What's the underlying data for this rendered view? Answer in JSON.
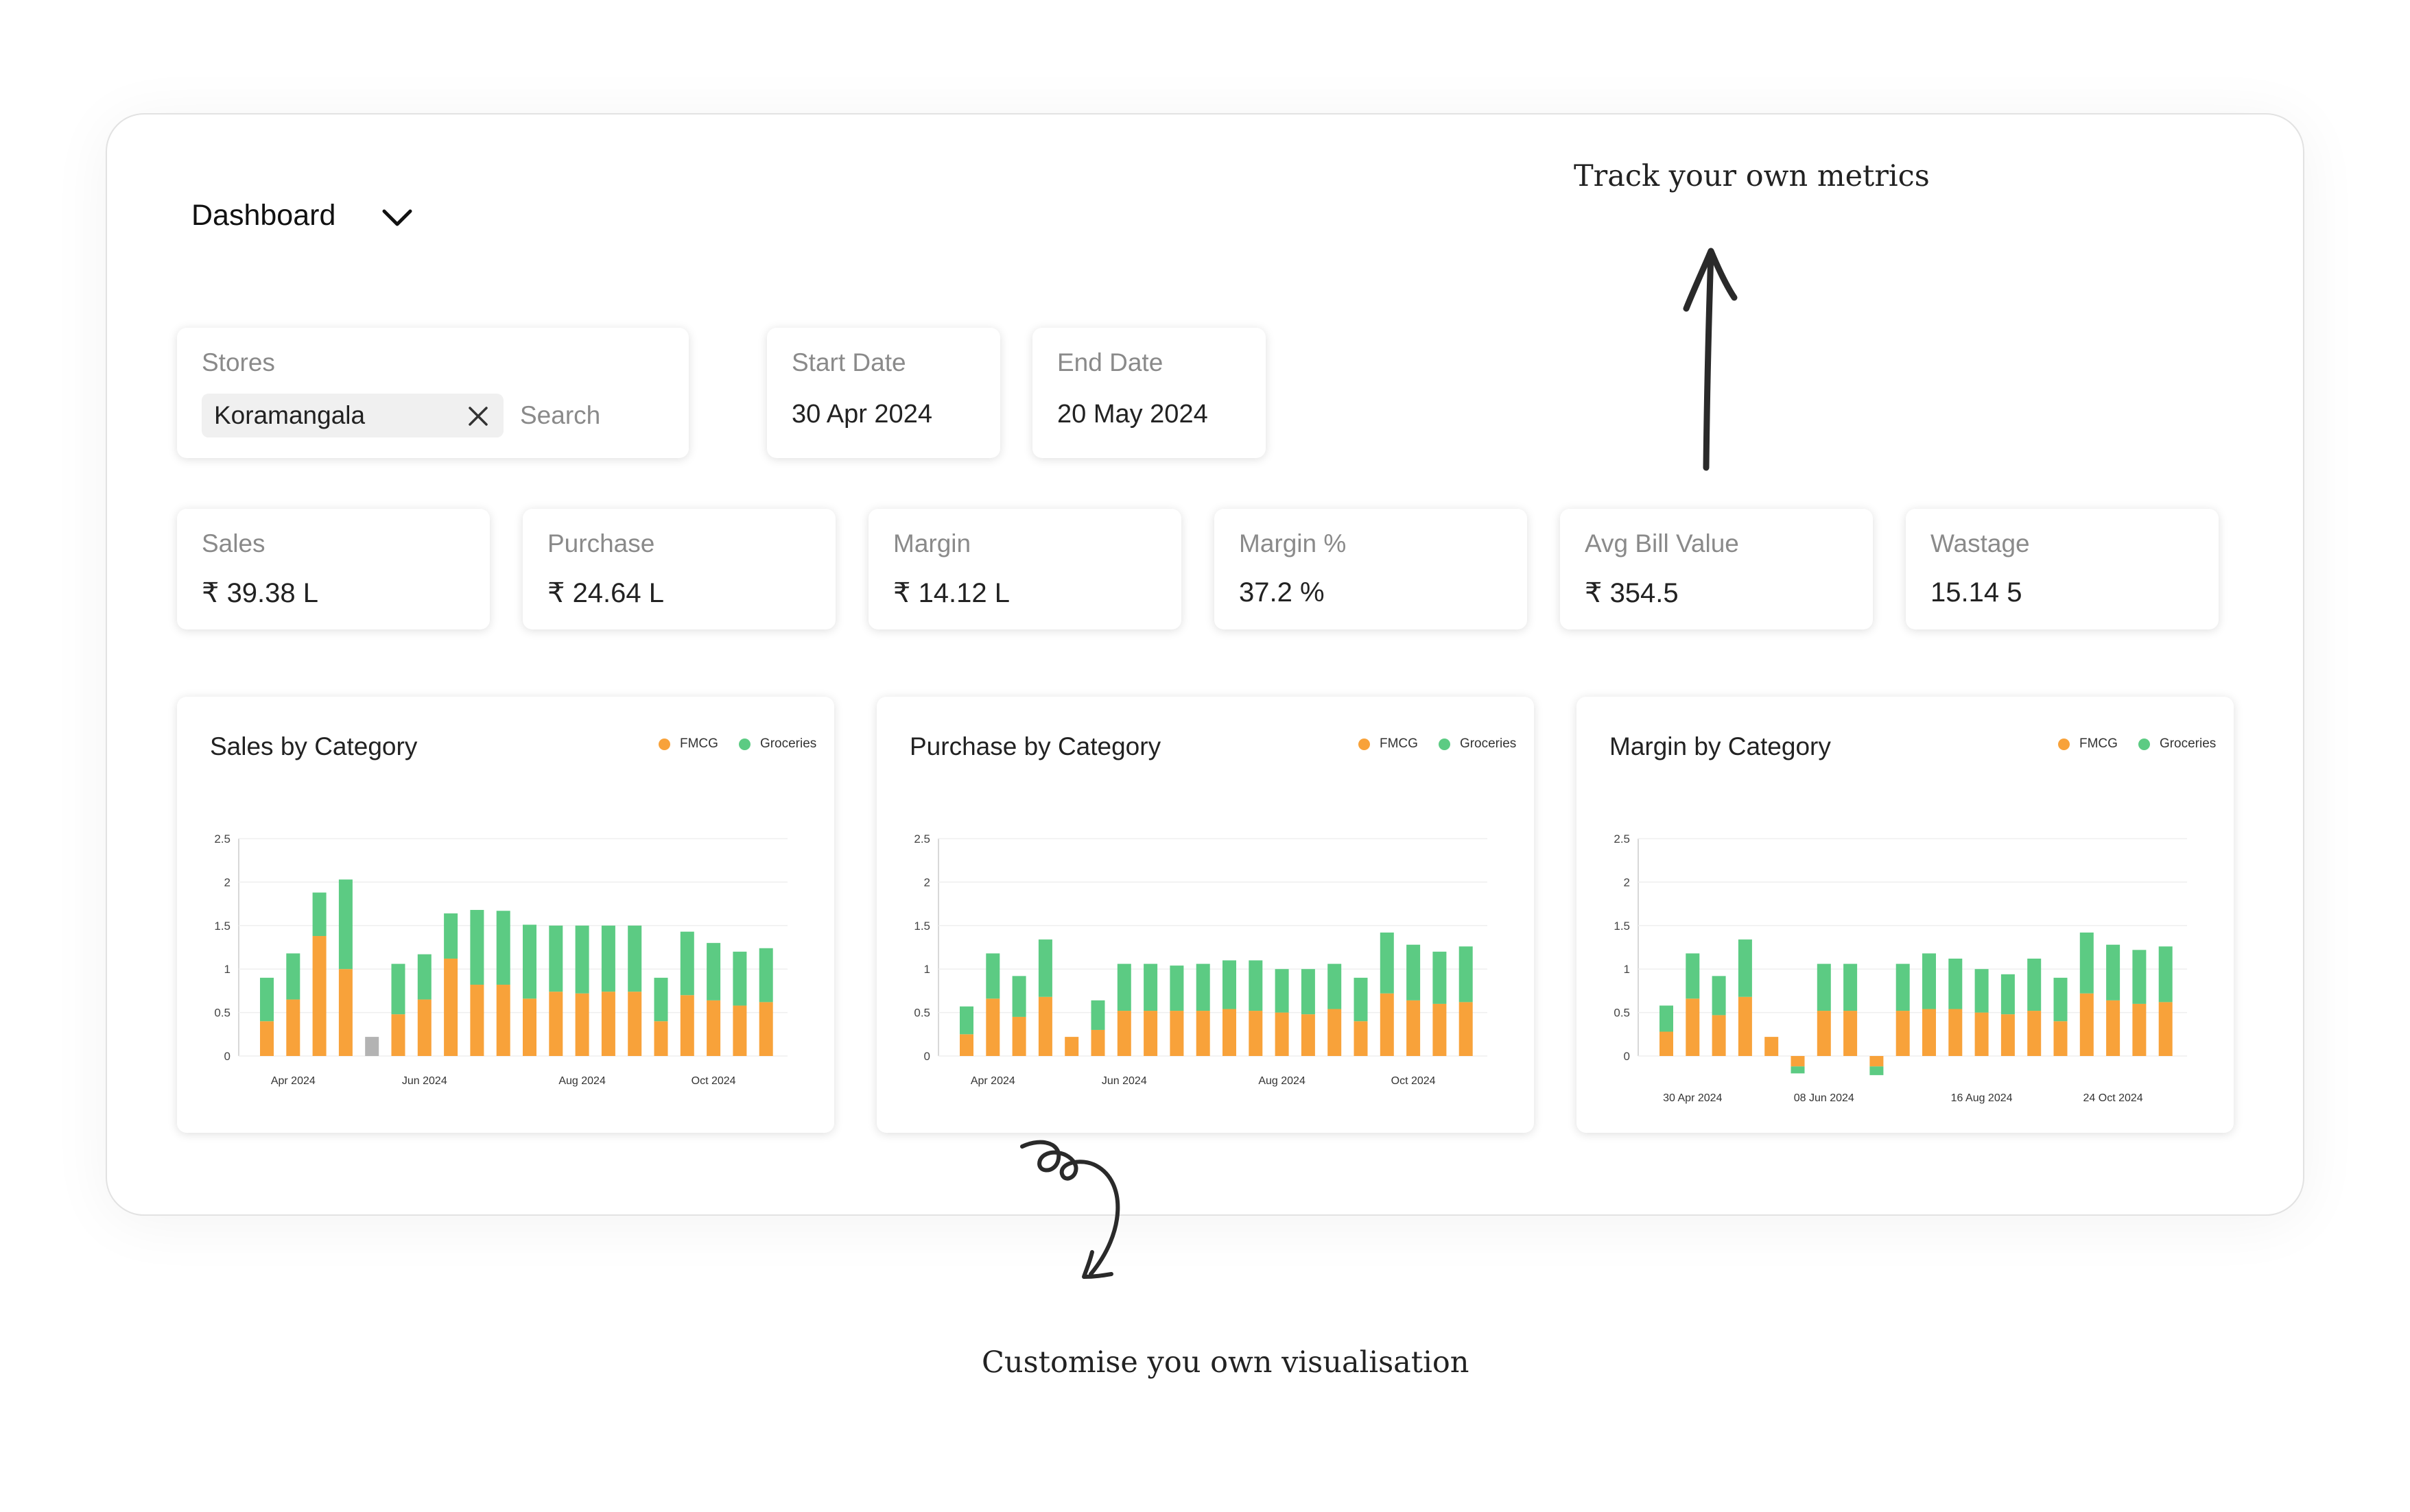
{
  "header": {
    "title": "Dashboard",
    "dropdown_icon": "chevron-down-icon"
  },
  "filters": {
    "stores": {
      "label": "Stores",
      "chip": "Koramangala",
      "placeholder": "Search"
    },
    "start_date": {
      "label": "Start Date",
      "value": "30 Apr 2024"
    },
    "end_date": {
      "label": "End Date",
      "value": "20 May 2024"
    }
  },
  "metrics": [
    {
      "label": "Sales",
      "value": "₹ 39.38 L"
    },
    {
      "label": "Purchase",
      "value": "₹ 24.64 L"
    },
    {
      "label": "Margin",
      "value": "₹ 14.12 L"
    },
    {
      "label": "Margin %",
      "value": "37.2 %"
    },
    {
      "label": "Avg Bill Value",
      "value": "₹ 354.5"
    },
    {
      "label": "Wastage",
      "value": "15.14 5"
    }
  ],
  "annotations": {
    "top": "Track your own metrics",
    "bottom": "Customise you own visualisation"
  },
  "colors": {
    "fmcg": "#F8A23A",
    "groceries": "#5CCB83",
    "other": "#B3B3B3"
  },
  "chart_data": [
    {
      "type": "bar",
      "stacked": true,
      "title": "Sales by Category",
      "legend": [
        "FMCG",
        "Groceries"
      ],
      "legend_position": "top-right",
      "ylim": [
        0,
        2.5
      ],
      "yticks": [
        "2.5",
        "2",
        "1.5",
        "1",
        "0.5",
        "0"
      ],
      "xtick_labels": [
        {
          "index": 1,
          "label": "Apr 2024"
        },
        {
          "index": 6,
          "label": "Jun 2024"
        },
        {
          "index": 12,
          "label": "Aug 2024"
        },
        {
          "index": 17,
          "label": "Oct 2024"
        }
      ],
      "series": [
        {
          "name": "FMCG",
          "values": [
            0.4,
            0.65,
            1.38,
            1.0,
            0.22,
            0.48,
            0.65,
            1.12,
            0.82,
            0.82,
            0.66,
            0.74,
            0.72,
            0.74,
            0.74,
            0.4,
            0.7,
            0.64,
            0.58,
            0.62
          ]
        },
        {
          "name": "Groceries",
          "values": [
            0.5,
            0.53,
            0.5,
            1.03,
            0,
            0.58,
            0.52,
            0.52,
            0.86,
            0.85,
            0.85,
            0.76,
            0.78,
            0.76,
            0.76,
            0.5,
            0.73,
            0.66,
            0.62,
            0.62
          ]
        }
      ],
      "other_bar": {
        "index": 4,
        "value": 0.22
      }
    },
    {
      "type": "bar",
      "stacked": true,
      "title": "Purchase by Category",
      "legend": [
        "FMCG",
        "Groceries"
      ],
      "legend_position": "top-right",
      "ylim": [
        0,
        2.5
      ],
      "yticks": [
        "2.5",
        "2",
        "1.5",
        "1",
        "0.5",
        "0"
      ],
      "xtick_labels": [
        {
          "index": 1,
          "label": "Apr 2024"
        },
        {
          "index": 6,
          "label": "Jun 2024"
        },
        {
          "index": 12,
          "label": "Aug 2024"
        },
        {
          "index": 17,
          "label": "Oct 2024"
        }
      ],
      "series": [
        {
          "name": "FMCG",
          "values": [
            0.25,
            0.66,
            0.45,
            0.68,
            0.22,
            0.3,
            0.52,
            0.52,
            0.52,
            0.52,
            0.54,
            0.52,
            0.5,
            0.48,
            0.54,
            0.4,
            0.72,
            0.64,
            0.6,
            0.62
          ]
        },
        {
          "name": "Groceries",
          "values": [
            0.32,
            0.52,
            0.47,
            0.66,
            0,
            0.34,
            0.54,
            0.54,
            0.52,
            0.54,
            0.56,
            0.58,
            0.5,
            0.52,
            0.52,
            0.5,
            0.7,
            0.64,
            0.6,
            0.64
          ]
        }
      ]
    },
    {
      "type": "bar",
      "stacked": true,
      "title": "Margin by Category",
      "legend": [
        "FMCG",
        "Groceries"
      ],
      "legend_position": "top-right",
      "ylim": [
        0,
        2.5
      ],
      "yticks": [
        "2.5",
        "2",
        "1.5",
        "1",
        "0.5",
        "0"
      ],
      "xtick_labels": [
        {
          "index": 1,
          "label": "30 Apr 2024"
        },
        {
          "index": 6,
          "label": "08 Jun 2024"
        },
        {
          "index": 12,
          "label": "16 Aug 2024"
        },
        {
          "index": 17,
          "label": "24 Oct 2024"
        }
      ],
      "series": [
        {
          "name": "FMCG",
          "values": [
            0.28,
            0.66,
            0.47,
            0.68,
            0.22,
            -0.12,
            0.52,
            0.52,
            -0.12,
            0.52,
            0.54,
            0.54,
            0.5,
            0.48,
            0.52,
            0.4,
            0.72,
            0.64,
            0.6,
            0.62
          ]
        },
        {
          "name": "Groceries",
          "values": [
            0.3,
            0.52,
            0.45,
            0.66,
            0,
            -0.08,
            0.54,
            0.54,
            -0.1,
            0.54,
            0.64,
            0.58,
            0.5,
            0.46,
            0.6,
            0.5,
            0.7,
            0.64,
            0.62,
            0.64
          ]
        }
      ]
    }
  ]
}
